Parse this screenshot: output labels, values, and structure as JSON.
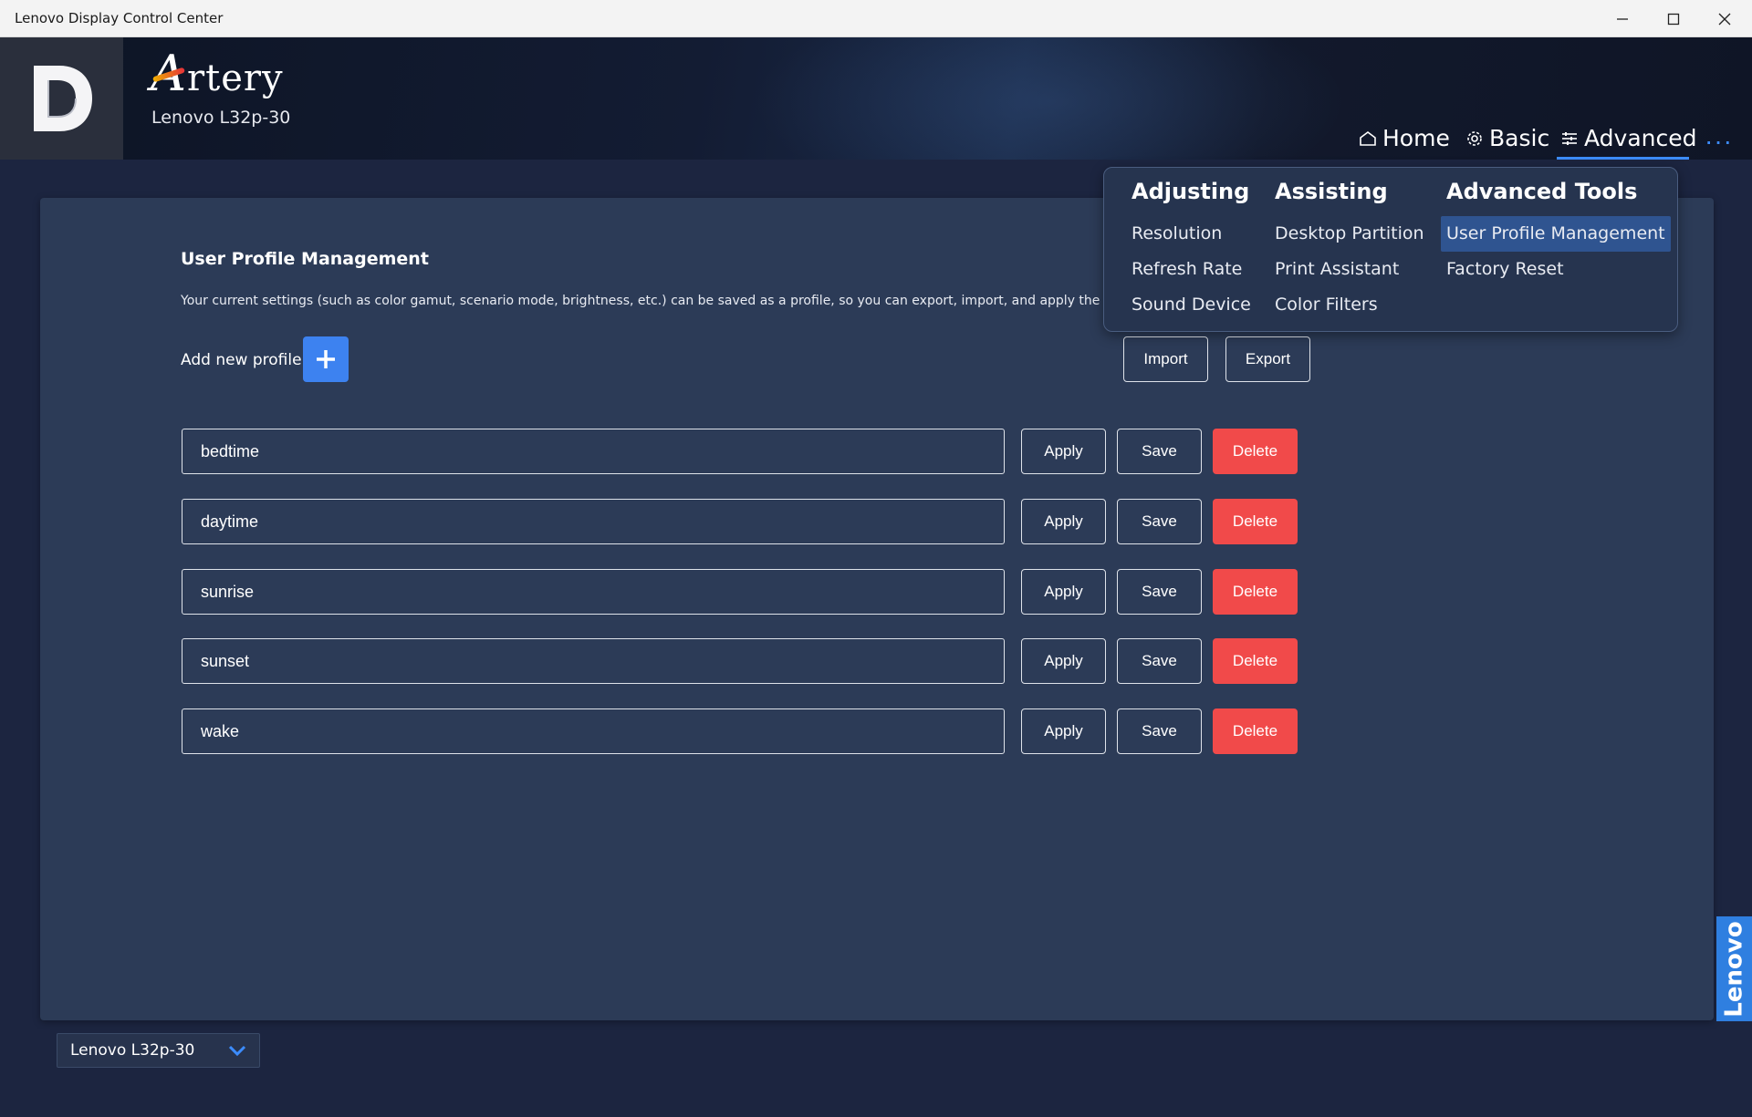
{
  "window": {
    "title": "Lenovo Display Control Center"
  },
  "header": {
    "brand": "Artery",
    "brand_first": "A",
    "brand_rest": "rtery",
    "model": "Lenovo L32p-30",
    "nav": {
      "home": "Home",
      "basic": "Basic",
      "advanced": "Advanced"
    },
    "more": "···",
    "colors": {
      "accent": "#3c8cff"
    }
  },
  "menu": {
    "columns": [
      {
        "heading": "Adjusting",
        "items": [
          "Resolution",
          "Refresh Rate",
          "Sound Device"
        ]
      },
      {
        "heading": "Assisting",
        "items": [
          "Desktop Partition",
          "Print Assistant",
          "Color Filters"
        ]
      },
      {
        "heading": "Advanced Tools",
        "items": [
          "User Profile Management",
          "Factory Reset"
        ]
      }
    ],
    "active": "User Profile Management"
  },
  "main": {
    "title": "User Profile Management",
    "description": "Your current settings (such as color gamut, scenario mode, brightness, etc.) can be saved as a profile, so you can export, import, and apply the profile wher",
    "add_label": "Add new profile",
    "import_label": "Import",
    "export_label": "Export",
    "profiles": [
      "bedtime",
      "daytime",
      "sunrise",
      "sunset",
      "wake"
    ],
    "apply_label": "Apply",
    "save_label": "Save",
    "delete_label": "Delete",
    "colors": {
      "delete": "#f14a4a",
      "add": "#3d82f0"
    }
  },
  "footer": {
    "monitor_select": "Lenovo L32p-30",
    "brand_tab": "Lenovo"
  }
}
